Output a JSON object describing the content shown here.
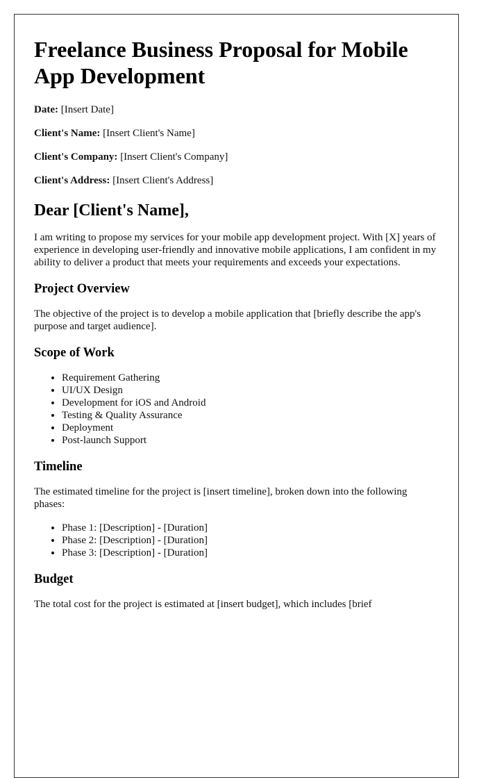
{
  "document": {
    "title": "Freelance Business Proposal for Mobile App Development",
    "meta": [
      {
        "label": "Date:",
        "value": "[Insert Date]"
      },
      {
        "label": "Client's Name:",
        "value": "[Insert Client's Name]"
      },
      {
        "label": "Client's Company:",
        "value": "[Insert Client's Company]"
      },
      {
        "label": "Client's Address:",
        "value": "[Insert Client's Address]"
      }
    ],
    "salutation": "Dear [Client's Name],",
    "intro": "I am writing to propose my services for your mobile app development project. With [X] years of experience in developing user-friendly and innovative mobile applications, I am confident in my ability to deliver a product that meets your requirements and exceeds your expectations.",
    "sections": {
      "overview": {
        "heading": "Project Overview",
        "text": "The objective of the project is to develop a mobile application that [briefly describe the app's purpose and target audience]."
      },
      "scope": {
        "heading": "Scope of Work",
        "items": [
          "Requirement Gathering",
          "UI/UX Design",
          "Development for iOS and Android",
          "Testing & Quality Assurance",
          "Deployment",
          "Post-launch Support"
        ]
      },
      "timeline": {
        "heading": "Timeline",
        "text": "The estimated timeline for the project is [insert timeline], broken down into the following phases:",
        "items": [
          "Phase 1: [Description] - [Duration]",
          "Phase 2: [Description] - [Duration]",
          "Phase 3: [Description] - [Duration]"
        ]
      },
      "budget": {
        "heading": "Budget",
        "text": "The total cost for the project is estimated at [insert budget], which includes [brief"
      }
    }
  }
}
